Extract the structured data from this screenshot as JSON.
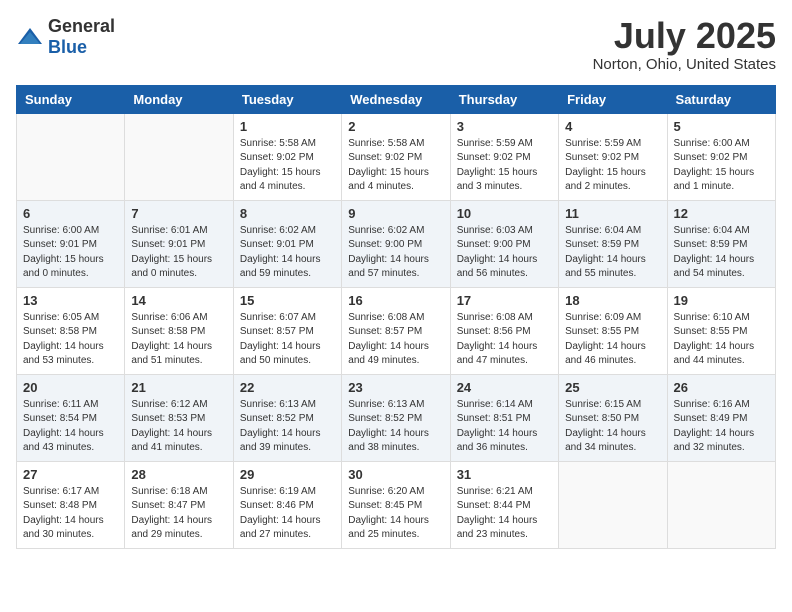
{
  "header": {
    "logo_general": "General",
    "logo_blue": "Blue",
    "title": "July 2025",
    "subtitle": "Norton, Ohio, United States"
  },
  "weekdays": [
    "Sunday",
    "Monday",
    "Tuesday",
    "Wednesday",
    "Thursday",
    "Friday",
    "Saturday"
  ],
  "weeks": [
    [
      {
        "day": "",
        "info": ""
      },
      {
        "day": "",
        "info": ""
      },
      {
        "day": "1",
        "info": "Sunrise: 5:58 AM\nSunset: 9:02 PM\nDaylight: 15 hours and 4 minutes."
      },
      {
        "day": "2",
        "info": "Sunrise: 5:58 AM\nSunset: 9:02 PM\nDaylight: 15 hours and 4 minutes."
      },
      {
        "day": "3",
        "info": "Sunrise: 5:59 AM\nSunset: 9:02 PM\nDaylight: 15 hours and 3 minutes."
      },
      {
        "day": "4",
        "info": "Sunrise: 5:59 AM\nSunset: 9:02 PM\nDaylight: 15 hours and 2 minutes."
      },
      {
        "day": "5",
        "info": "Sunrise: 6:00 AM\nSunset: 9:02 PM\nDaylight: 15 hours and 1 minute."
      }
    ],
    [
      {
        "day": "6",
        "info": "Sunrise: 6:00 AM\nSunset: 9:01 PM\nDaylight: 15 hours and 0 minutes."
      },
      {
        "day": "7",
        "info": "Sunrise: 6:01 AM\nSunset: 9:01 PM\nDaylight: 15 hours and 0 minutes."
      },
      {
        "day": "8",
        "info": "Sunrise: 6:02 AM\nSunset: 9:01 PM\nDaylight: 14 hours and 59 minutes."
      },
      {
        "day": "9",
        "info": "Sunrise: 6:02 AM\nSunset: 9:00 PM\nDaylight: 14 hours and 57 minutes."
      },
      {
        "day": "10",
        "info": "Sunrise: 6:03 AM\nSunset: 9:00 PM\nDaylight: 14 hours and 56 minutes."
      },
      {
        "day": "11",
        "info": "Sunrise: 6:04 AM\nSunset: 8:59 PM\nDaylight: 14 hours and 55 minutes."
      },
      {
        "day": "12",
        "info": "Sunrise: 6:04 AM\nSunset: 8:59 PM\nDaylight: 14 hours and 54 minutes."
      }
    ],
    [
      {
        "day": "13",
        "info": "Sunrise: 6:05 AM\nSunset: 8:58 PM\nDaylight: 14 hours and 53 minutes."
      },
      {
        "day": "14",
        "info": "Sunrise: 6:06 AM\nSunset: 8:58 PM\nDaylight: 14 hours and 51 minutes."
      },
      {
        "day": "15",
        "info": "Sunrise: 6:07 AM\nSunset: 8:57 PM\nDaylight: 14 hours and 50 minutes."
      },
      {
        "day": "16",
        "info": "Sunrise: 6:08 AM\nSunset: 8:57 PM\nDaylight: 14 hours and 49 minutes."
      },
      {
        "day": "17",
        "info": "Sunrise: 6:08 AM\nSunset: 8:56 PM\nDaylight: 14 hours and 47 minutes."
      },
      {
        "day": "18",
        "info": "Sunrise: 6:09 AM\nSunset: 8:55 PM\nDaylight: 14 hours and 46 minutes."
      },
      {
        "day": "19",
        "info": "Sunrise: 6:10 AM\nSunset: 8:55 PM\nDaylight: 14 hours and 44 minutes."
      }
    ],
    [
      {
        "day": "20",
        "info": "Sunrise: 6:11 AM\nSunset: 8:54 PM\nDaylight: 14 hours and 43 minutes."
      },
      {
        "day": "21",
        "info": "Sunrise: 6:12 AM\nSunset: 8:53 PM\nDaylight: 14 hours and 41 minutes."
      },
      {
        "day": "22",
        "info": "Sunrise: 6:13 AM\nSunset: 8:52 PM\nDaylight: 14 hours and 39 minutes."
      },
      {
        "day": "23",
        "info": "Sunrise: 6:13 AM\nSunset: 8:52 PM\nDaylight: 14 hours and 38 minutes."
      },
      {
        "day": "24",
        "info": "Sunrise: 6:14 AM\nSunset: 8:51 PM\nDaylight: 14 hours and 36 minutes."
      },
      {
        "day": "25",
        "info": "Sunrise: 6:15 AM\nSunset: 8:50 PM\nDaylight: 14 hours and 34 minutes."
      },
      {
        "day": "26",
        "info": "Sunrise: 6:16 AM\nSunset: 8:49 PM\nDaylight: 14 hours and 32 minutes."
      }
    ],
    [
      {
        "day": "27",
        "info": "Sunrise: 6:17 AM\nSunset: 8:48 PM\nDaylight: 14 hours and 30 minutes."
      },
      {
        "day": "28",
        "info": "Sunrise: 6:18 AM\nSunset: 8:47 PM\nDaylight: 14 hours and 29 minutes."
      },
      {
        "day": "29",
        "info": "Sunrise: 6:19 AM\nSunset: 8:46 PM\nDaylight: 14 hours and 27 minutes."
      },
      {
        "day": "30",
        "info": "Sunrise: 6:20 AM\nSunset: 8:45 PM\nDaylight: 14 hours and 25 minutes."
      },
      {
        "day": "31",
        "info": "Sunrise: 6:21 AM\nSunset: 8:44 PM\nDaylight: 14 hours and 23 minutes."
      },
      {
        "day": "",
        "info": ""
      },
      {
        "day": "",
        "info": ""
      }
    ]
  ]
}
